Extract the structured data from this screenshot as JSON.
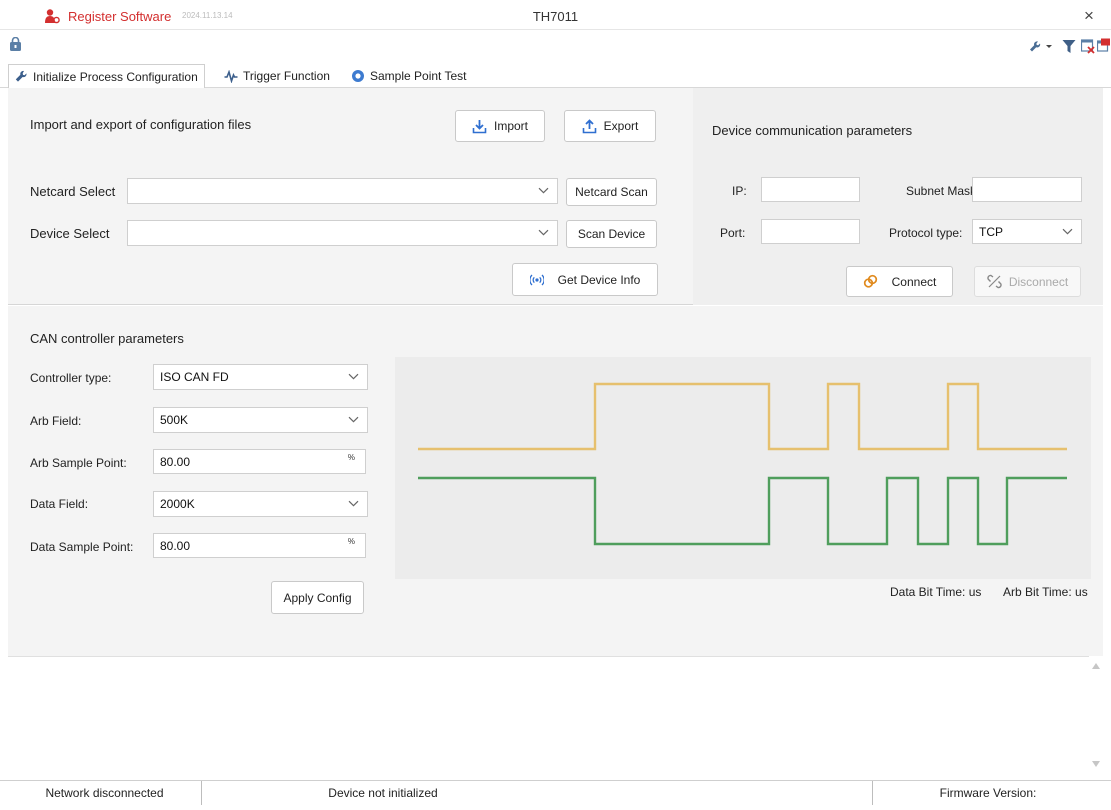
{
  "title_bar": {
    "app_name": "Register Software",
    "version": "2024.11.13.14",
    "window_title": "TH7011",
    "close_glyph": "×"
  },
  "toolbar": {
    "icons": [
      "lock-icon",
      "wrench-dropdown-icon",
      "filter-icon",
      "close-window-icon",
      "export-window-icon"
    ]
  },
  "tabs": [
    {
      "label": "Initialize Process Configuration",
      "icon": "wrench-icon",
      "active": true
    },
    {
      "label": "Trigger Function",
      "icon": "pulse-icon",
      "active": false
    },
    {
      "label": "Sample Point Test",
      "icon": "target-icon",
      "active": false
    }
  ],
  "config_files": {
    "label": "Import and export of configuration files",
    "import_label": "Import",
    "export_label": "Export"
  },
  "netcard": {
    "label": "Netcard Select",
    "value": "",
    "scan_label": "Netcard Scan"
  },
  "device": {
    "label": "Device Select",
    "value": "",
    "scan_label": "Scan Device",
    "info_label": "Get Device Info"
  },
  "comm": {
    "title": "Device communication parameters",
    "ip_label": "IP:",
    "ip_value": "",
    "subnet_label": "Subnet Mask:",
    "subnet_value": "",
    "port_label": "Port:",
    "port_value": "",
    "protocol_label": "Protocol type:",
    "protocol_value": "TCP",
    "connect_label": "Connect",
    "disconnect_label": "Disconnect"
  },
  "can": {
    "title": "CAN controller parameters",
    "controller_type_label": "Controller type:",
    "controller_type_value": "ISO CAN FD",
    "arb_field_label": "Arb Field:",
    "arb_field_value": "500K",
    "arb_sample_label": "Arb Sample Point:",
    "arb_sample_value": "80.00",
    "data_field_label": "Data Field:",
    "data_field_value": "2000K",
    "data_sample_label": "Data Sample Point:",
    "data_sample_value": "80.00",
    "percent_unit": "%",
    "apply_label": "Apply Config",
    "data_bit_time": "Data Bit Time: us",
    "arb_bit_time": "Arb Bit Time: us"
  },
  "waveform_colors": {
    "yellow": "#e6c06e",
    "green": "#4f9e5c"
  },
  "status": {
    "network": "Network disconnected",
    "device": "Device not initialized",
    "firmware": "Firmware Version:"
  }
}
